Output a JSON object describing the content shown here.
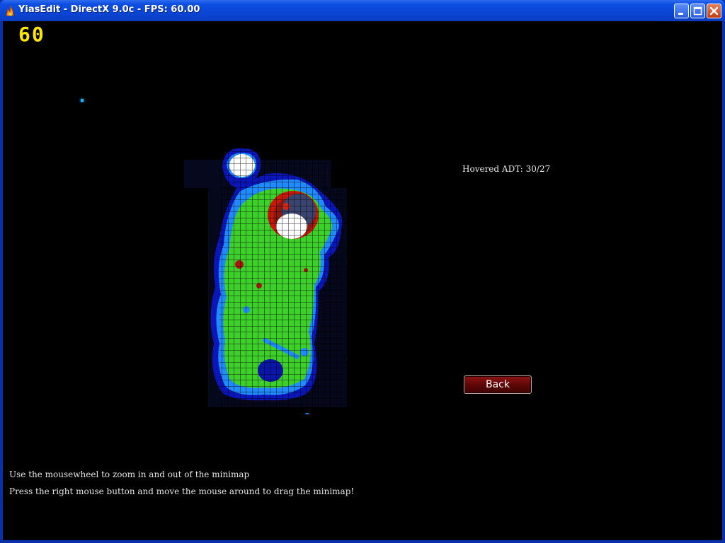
{
  "window": {
    "title": "YiasEdit - DirectX 9.0c - FPS: 60.00",
    "icon": "flame-icon",
    "controls": {
      "minimize": "minimize-icon",
      "maximize": "maximize-icon",
      "close": "close-icon"
    }
  },
  "overlay": {
    "fps_counter": "60"
  },
  "minimap": {
    "hovered_label": "Hovered ADT: 30/27",
    "colors": {
      "land": "#3ecf2a",
      "water_shallow": "#1a8cff",
      "water_deep": "#0a1aa0",
      "snow": "#ffffff",
      "lava_red": "#c81a0a",
      "grid": "#000000"
    }
  },
  "buttons": {
    "back": "Back"
  },
  "hints": [
    "Use the mousewheel to zoom in and out of the minimap",
    "Press the right mouse button and move the mouse around to drag the minimap!"
  ]
}
